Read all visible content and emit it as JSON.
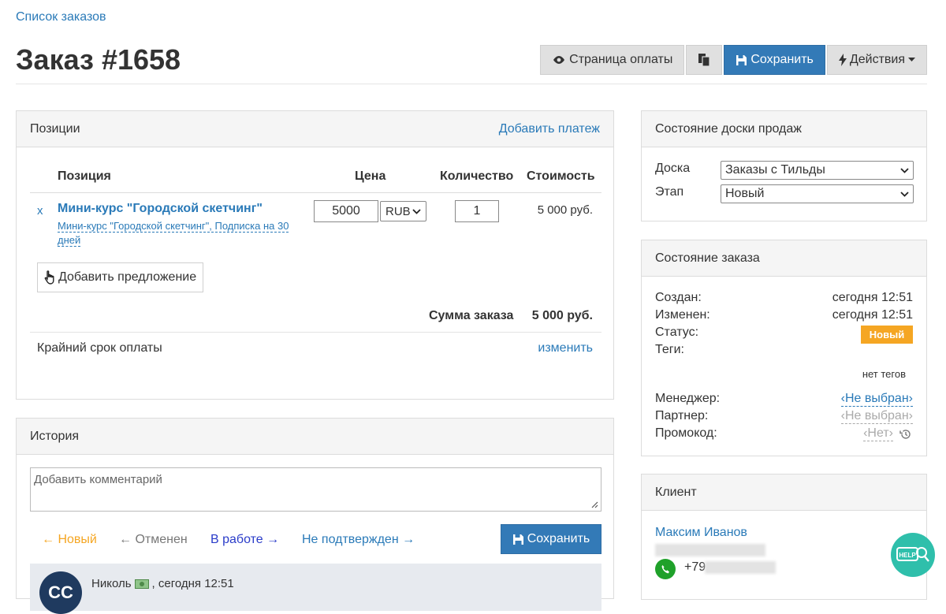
{
  "breadcrumb": "Список заказов",
  "title": "Заказ #1658",
  "toolbar": {
    "payment_page": "Страница оплаты",
    "save": "Сохранить",
    "actions": "Действия"
  },
  "positions": {
    "heading": "Позиции",
    "add_payment": "Добавить платеж",
    "columns": {
      "position": "Позиция",
      "price": "Цена",
      "quantity": "Количество",
      "cost": "Стоимость"
    },
    "row": {
      "remove": "x",
      "title": "Мини-курс \"Городской скетчинг\"",
      "subtitle": "Мини-курс \"Городской скетчинг\", Подписка на 30 дней",
      "price": "5000",
      "currency": "RUB",
      "quantity": "1",
      "cost": "5 000 руб."
    },
    "add_offer": "Добавить предложение",
    "sum_label": "Сумма заказа",
    "sum_value": "5 000 руб.",
    "deadline_label": "Крайний срок оплаты",
    "deadline_change": "изменить"
  },
  "history": {
    "heading": "История",
    "comment_placeholder": "Добавить комментарий",
    "statuses": [
      "← Новый",
      "← Отменен",
      "В работе →",
      "Не подтвержден →"
    ],
    "save": "Сохранить",
    "entry": {
      "avatar": "CC",
      "author": "Николь",
      "time": ", сегодня 12:51"
    }
  },
  "board": {
    "heading": "Состояние доски продаж",
    "board_label": "Доска",
    "board_value": "Заказы с Тильды",
    "stage_label": "Этап",
    "stage_value": "Новый"
  },
  "order_state": {
    "heading": "Состояние заказа",
    "created_label": "Создан:",
    "created_value": "сегодня 12:51",
    "modified_label": "Изменен:",
    "modified_value": "сегодня 12:51",
    "status_label": "Статус:",
    "status_value": "Новый",
    "status_color": "#f5a623",
    "tags_label": "Теги:",
    "tags_value": "нет тегов",
    "manager_label": "Менеджер:",
    "manager_value": "‹Не выбран›",
    "partner_label": "Партнер:",
    "partner_value": "‹Не выбран›",
    "promo_label": "Промокод:",
    "promo_value": "‹Нет›"
  },
  "client": {
    "heading": "Клиент",
    "name": "Максим Иванов",
    "phone_prefix": "+79"
  },
  "help": {
    "label": "HELP"
  },
  "colors": {
    "accent": "#337ab7",
    "link": "#2a7ab8",
    "new_status": "#f5a623",
    "help": "#2fbfab"
  }
}
